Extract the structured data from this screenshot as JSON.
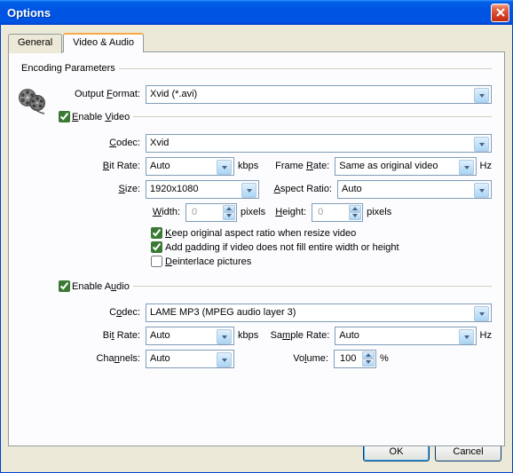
{
  "window": {
    "title": "Options"
  },
  "tabs": {
    "general": "General",
    "video_audio": "Video & Audio"
  },
  "group": {
    "encoding": "Encoding Parameters"
  },
  "output": {
    "label": "Output Format:",
    "value": "Xvid (*.avi)"
  },
  "enable_video": "Enable Video",
  "video": {
    "codec_label": "Codec:",
    "codec_value": "Xvid",
    "bitrate_label": "Bit Rate:",
    "bitrate_value": "Auto",
    "bitrate_unit": "kbps",
    "framerate_label": "Frame Rate:",
    "framerate_value": "Same as original video",
    "framerate_unit": "Hz",
    "size_label": "Size:",
    "size_value": "1920x1080",
    "aspect_label": "Aspect Ratio:",
    "aspect_value": "Auto",
    "width_label": "Width:",
    "width_value": "0",
    "width_unit": "pixels",
    "height_label": "Height:",
    "height_value": "0",
    "height_unit": "pixels",
    "keep_aspect": "Keep original aspect ratio when resize video",
    "add_padding": "Add padding if video does not fill entire width or height",
    "deinterlace": "Deinterlace pictures"
  },
  "enable_audio": "Enable Audio",
  "audio": {
    "codec_label": "Codec:",
    "codec_value": "LAME MP3 (MPEG audio layer 3)",
    "bitrate_label": "Bit Rate:",
    "bitrate_value": "Auto",
    "bitrate_unit": "kbps",
    "samplerate_label": "Sample Rate:",
    "samplerate_value": "Auto",
    "samplerate_unit": "Hz",
    "channels_label": "Channels:",
    "channels_value": "Auto",
    "volume_label": "Volume:",
    "volume_value": "100",
    "volume_unit": "%"
  },
  "buttons": {
    "ok": "OK",
    "cancel": "Cancel"
  },
  "letters": {
    "O": "O",
    "F": "F",
    "E": "E",
    "V": "V",
    "C": "C",
    "B": "B",
    "R": "R",
    "S": "S",
    "A": "A",
    "W": "W",
    "H": "H",
    "K": "K",
    "p": "p",
    "D": "D",
    "u": "u",
    "n": "n",
    "m": "m",
    "l": "l"
  }
}
